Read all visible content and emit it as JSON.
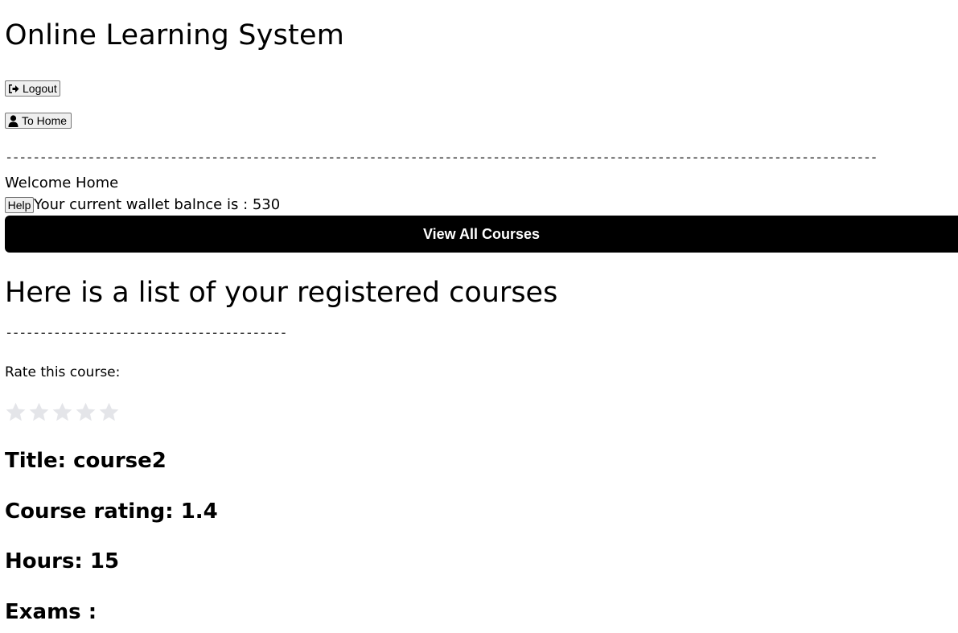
{
  "app": {
    "title": "Online Learning System"
  },
  "header": {
    "logout_label": "Logout",
    "logout_icon": "sign-out-icon",
    "home_label": "To Home",
    "home_icon": "user-icon"
  },
  "dividers": {
    "top": "-------------------------------------------------------------------------------------------------------------------------------",
    "section": "-----------------------------------------"
  },
  "welcome": {
    "text": "Welcome Home",
    "help_label": "Help",
    "wallet_text": "Your current wallet balnce is : 530"
  },
  "courses_button": {
    "label": "View All Courses"
  },
  "registered": {
    "heading": "Here is a list of your registered courses",
    "rate_label": "Rate this course:",
    "user_rating": 0,
    "max_rating": 5,
    "star_color_inactive": "#e4e5e9",
    "course": {
      "title_text": "Title: course2",
      "rating_text": "Course rating: 1.4",
      "hours_text": "Hours: 15",
      "exams_text": "Exams :"
    }
  }
}
